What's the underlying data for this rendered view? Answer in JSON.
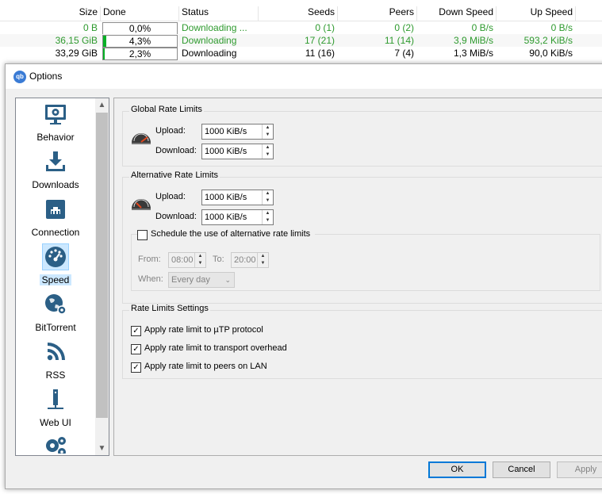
{
  "torrent_list": {
    "headers": [
      "Size",
      "Done",
      "Status",
      "Seeds",
      "Peers",
      "Down Speed",
      "Up Speed"
    ],
    "rows": [
      {
        "size": "0 B",
        "done": "0,0%",
        "progress": 0.0,
        "status": "Downloading ...",
        "seeds": "0 (1)",
        "peers": "0 (2)",
        "down": "0 B/s",
        "up": "0 B/s",
        "color": "#2e9a2e"
      },
      {
        "size": "36,15 GiB",
        "done": "4,3%",
        "progress": 0.043,
        "status": "Downloading",
        "seeds": "17 (21)",
        "peers": "11 (14)",
        "down": "3,9 MiB/s",
        "up": "593,2 KiB/s",
        "color": "#2e9a2e"
      },
      {
        "size": "33,29 GiB",
        "done": "2,3%",
        "progress": 0.023,
        "status": "Downloading",
        "seeds": "11 (16)",
        "peers": "7 (4)",
        "down": "1,3 MiB/s",
        "up": "90,0 KiB/s",
        "color": "#000000"
      }
    ]
  },
  "dialog": {
    "title": "Options",
    "app_icon": "qb",
    "sidebar": [
      {
        "label": "Behavior",
        "icon": "monitor-gear-icon"
      },
      {
        "label": "Downloads",
        "icon": "download-tray-icon"
      },
      {
        "label": "Connection",
        "icon": "network-port-icon"
      },
      {
        "label": "Speed",
        "icon": "speedometer-icon",
        "selected": true
      },
      {
        "label": "BitTorrent",
        "icon": "globe-gear-icon"
      },
      {
        "label": "RSS",
        "icon": "rss-icon"
      },
      {
        "label": "Web UI",
        "icon": "web-server-icon"
      },
      {
        "label": "",
        "icon": "gears-icon"
      }
    ],
    "speed": {
      "global": {
        "title": "Global Rate Limits",
        "upload_label": "Upload:",
        "upload_value": "1000 KiB/s",
        "download_label": "Download:",
        "download_value": "1000 KiB/s"
      },
      "alternative": {
        "title": "Alternative Rate Limits",
        "upload_label": "Upload:",
        "upload_value": "1000 KiB/s",
        "download_label": "Download:",
        "download_value": "1000 KiB/s",
        "schedule": {
          "label": "Schedule the use of alternative rate limits",
          "checked": false,
          "from_label": "From:",
          "from_value": "08:00",
          "to_label": "To:",
          "to_value": "20:00",
          "when_label": "When:",
          "when_value": "Every day"
        }
      },
      "settings": {
        "title": "Rate Limits Settings",
        "options": [
          {
            "label": "Apply rate limit to µTP protocol",
            "checked": true
          },
          {
            "label": "Apply rate limit to transport overhead",
            "checked": true
          },
          {
            "label": "Apply rate limit to peers on LAN",
            "checked": true
          }
        ]
      }
    },
    "buttons": {
      "ok": "OK",
      "cancel": "Cancel",
      "apply": "Apply"
    },
    "colors": {
      "accent": "#0078d7",
      "selection": "#cce8ff",
      "progress": "#06b025",
      "icon": "#2b5f86"
    }
  }
}
